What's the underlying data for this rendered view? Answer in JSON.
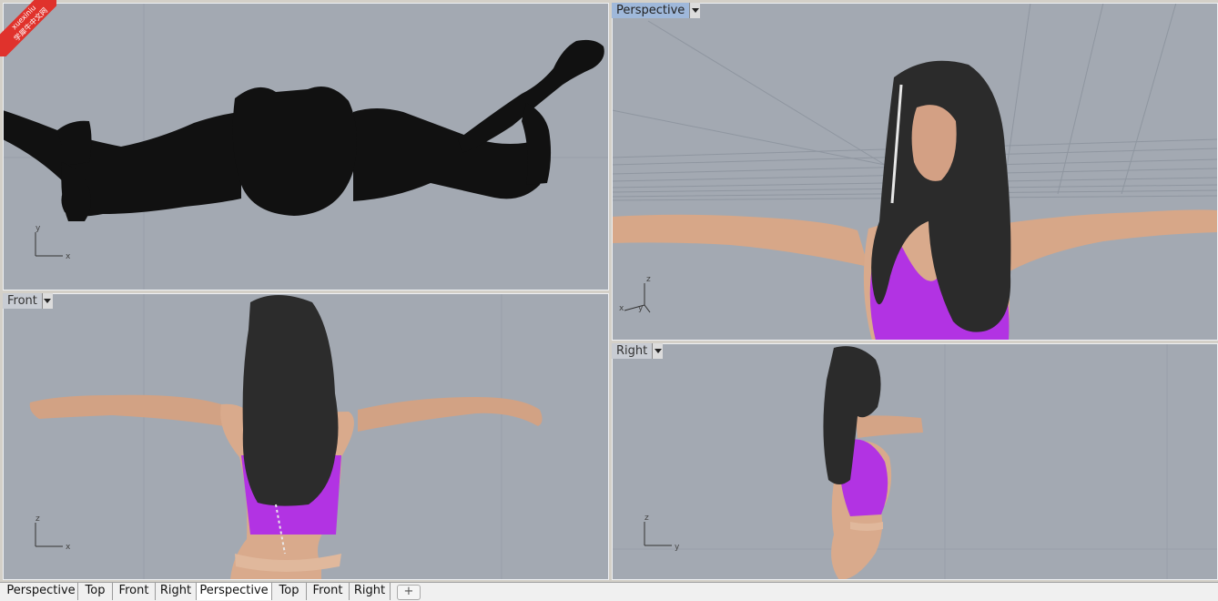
{
  "watermark": {
    "brand": "xuexiniu",
    "cn": "学犀牛中文网"
  },
  "viewports": {
    "top": {
      "axis_x": "x",
      "axis_y": "y"
    },
    "front": {
      "label": "Front",
      "axis_x": "x",
      "axis_y": "z"
    },
    "perspective": {
      "label": "Perspective",
      "axis_x": "x",
      "axis_y": "y",
      "axis_z": "z"
    },
    "right": {
      "label": "Right",
      "axis_x": "y",
      "axis_y": "z"
    }
  },
  "tabs": [
    {
      "label": "Perspective"
    },
    {
      "label": "Top"
    },
    {
      "label": "Front"
    },
    {
      "label": "Right"
    },
    {
      "label": "Perspective",
      "active": true
    },
    {
      "label": "Top"
    },
    {
      "label": "Front"
    },
    {
      "label": "Right"
    }
  ],
  "add_tab": "+",
  "colors": {
    "viewport_bg": "#a3a9b2",
    "active_label": "#9fb8da",
    "garment": "#b233e3",
    "hair": "#2b2b2b",
    "skin": "#d9a98a"
  }
}
